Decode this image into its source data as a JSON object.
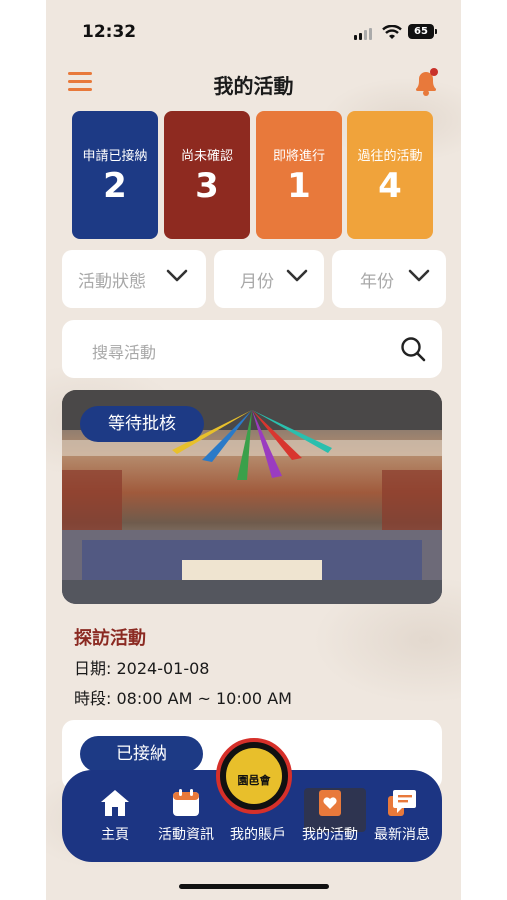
{
  "status_bar": {
    "time": "12:32",
    "battery": "65"
  },
  "header": {
    "title": "我的活動"
  },
  "summary_cards": [
    {
      "label": "申請已接納",
      "count": "2",
      "color": "#1d3a85"
    },
    {
      "label": "尚未確認",
      "count": "3",
      "color": "#8e2a20"
    },
    {
      "label": "即將進行",
      "count": "1",
      "color": "#e8793b"
    },
    {
      "label": "過往的活動",
      "count": "4",
      "color": "#f0a33b"
    }
  ],
  "filters": {
    "status": "活動狀態",
    "month": "月份",
    "year": "年份"
  },
  "search": {
    "placeholder": "搜尋活動"
  },
  "event": {
    "status_tag": "等待批核",
    "name": "探訪活動",
    "date": "日期: 2024-01-08",
    "time": "時段: 08:00 AM ~ 10:00 AM"
  },
  "next_event": {
    "status_tag": "已接納"
  },
  "logo": {
    "text": "園邑會"
  },
  "bottom_nav": [
    {
      "label": "主頁",
      "icon": "home-icon"
    },
    {
      "label": "活動資訊",
      "icon": "calendar-icon"
    },
    {
      "label": "我的賬戶",
      "icon": "account-icon"
    },
    {
      "label": "我的活動",
      "icon": "my-activity-icon"
    },
    {
      "label": "最新消息",
      "icon": "news-icon"
    }
  ],
  "colors": {
    "accent": "#e8793b",
    "nav": "#1c3583",
    "title_red": "#8b2a22"
  }
}
